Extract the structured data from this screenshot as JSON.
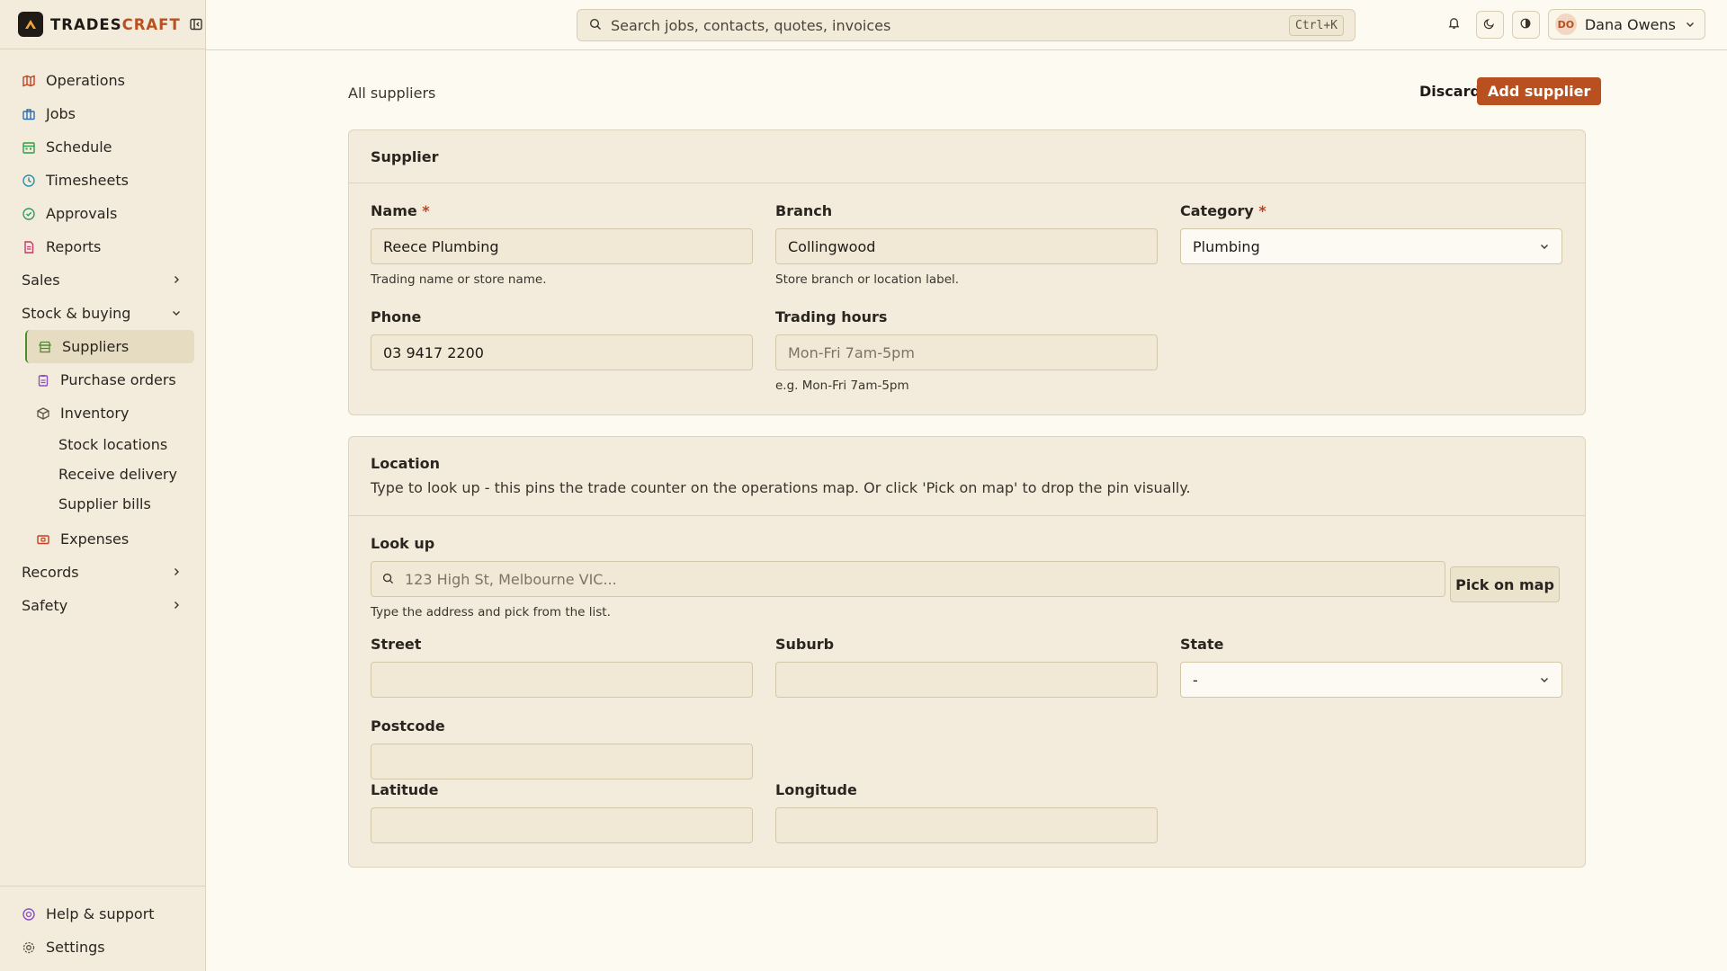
{
  "brand": {
    "name_main": "TRADES",
    "name_accent": "CRAFT"
  },
  "sidebar": {
    "items": [
      {
        "label": "Operations",
        "icon": "map-icon",
        "color": "#c2411e"
      },
      {
        "label": "Jobs",
        "icon": "briefcase-icon",
        "color": "#2f6fb0"
      },
      {
        "label": "Schedule",
        "icon": "calendar-icon",
        "color": "#2f9a4a"
      },
      {
        "label": "Timesheets",
        "icon": "clock-icon",
        "color": "#2a8fa8"
      },
      {
        "label": "Approvals",
        "icon": "check-circle-icon",
        "color": "#2f9a6a"
      },
      {
        "label": "Reports",
        "icon": "report-icon",
        "color": "#c23a6a"
      }
    ],
    "groups": {
      "sales": "Sales",
      "stock": "Stock & buying",
      "records": "Records",
      "safety": "Safety"
    },
    "stock_items": [
      {
        "label": "Suppliers",
        "icon": "store-icon",
        "color": "#4c8a2f",
        "active": true
      },
      {
        "label": "Purchase orders",
        "icon": "clipboard-icon",
        "color": "#8a4fc2"
      },
      {
        "label": "Inventory",
        "icon": "box-icon",
        "color": "#5a5247"
      }
    ],
    "inventory_sub": [
      "Stock locations",
      "Receive delivery",
      "Supplier bills"
    ],
    "expenses": {
      "label": "Expenses",
      "icon": "wallet-icon",
      "color": "#c2411e"
    },
    "bottom": [
      {
        "label": "Help & support",
        "icon": "lifebuoy-icon",
        "color": "#8a4fc2"
      },
      {
        "label": "Settings",
        "icon": "gear-icon",
        "color": "#5a5247"
      }
    ]
  },
  "topbar": {
    "search_placeholder": "Search jobs, contacts, quotes, invoices",
    "shortcut": "Ctrl+K",
    "user": {
      "initials": "DO",
      "name": "Dana Owens"
    }
  },
  "page": {
    "breadcrumb": "All suppliers",
    "discard_label": "Discard",
    "submit_label": "Add supplier"
  },
  "supplier_card": {
    "title": "Supplier",
    "name": {
      "label": "Name",
      "value": "Reece Plumbing",
      "hint": "Trading name or store name."
    },
    "branch": {
      "label": "Branch",
      "value": "Collingwood",
      "hint": "Store branch or location label."
    },
    "category": {
      "label": "Category",
      "value": "Plumbing"
    },
    "phone": {
      "label": "Phone",
      "value": "03 9417 2200"
    },
    "hours": {
      "label": "Trading hours",
      "placeholder": "Mon-Fri 7am-5pm",
      "hint": "e.g. Mon-Fri 7am-5pm"
    }
  },
  "location_card": {
    "title": "Location",
    "description": "Type to look up - this pins the trade counter on the operations map. Or click 'Pick on map' to drop the pin visually.",
    "lookup": {
      "label": "Look up",
      "placeholder": "123 High St, Melbourne VIC...",
      "hint": "Type the address and pick from the list.",
      "pick_label": "Pick on map"
    },
    "street": {
      "label": "Street",
      "value": ""
    },
    "suburb": {
      "label": "Suburb",
      "value": ""
    },
    "state": {
      "label": "State",
      "value": "-"
    },
    "postcode": {
      "label": "Postcode",
      "value": ""
    },
    "latitude": {
      "label": "Latitude",
      "value": ""
    },
    "longitude": {
      "label": "Longitude",
      "value": ""
    }
  },
  "required_mark": "*",
  "colors": {
    "accent": "#b8501f",
    "background": "#fdfaf1",
    "panel": "#f3ecdc"
  }
}
